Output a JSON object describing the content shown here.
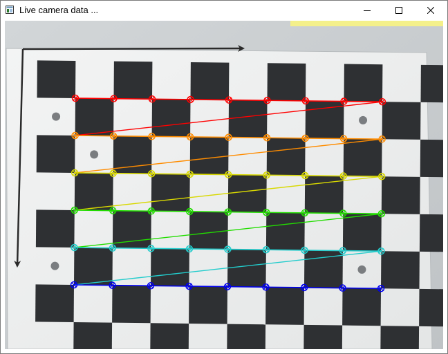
{
  "window": {
    "title": "Live camera data ...",
    "icon": "app-window-icon",
    "controls": {
      "minimize": "minimize-icon",
      "maximize": "maximize-icon",
      "close": "close-icon"
    }
  },
  "calibration": {
    "pattern": "checkerboard",
    "inner_corner_grid": {
      "columns": 9,
      "rows": 6
    },
    "row_colors": [
      "#ff0000",
      "#ff8c00",
      "#d8d800",
      "#22dd00",
      "#22cccc",
      "#0000ee"
    ],
    "annotations": {
      "scan_direction_arrows": [
        "arrow-right-icon",
        "arrow-down-icon"
      ]
    }
  }
}
